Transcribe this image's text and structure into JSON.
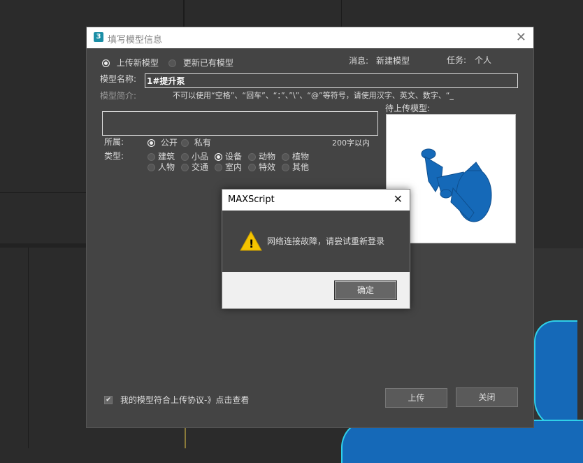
{
  "window": {
    "title": "填写模型信息",
    "close_glyph": "✕",
    "mode_new": "上传新模型",
    "mode_update": "更新已有模型",
    "message_label": "消息:",
    "message_value": "新建模型",
    "task_label": "任务:",
    "task_value": "个人",
    "name_label": "模型名称:",
    "name_value": "1#提升泵",
    "desc_label": "模型简介:",
    "desc_hint": "不可以使用“空格”、“回车”、“：”、”\\”、“@”等符号，请使用汉字、英文、数字、“_",
    "preview_label": "待上传模型:",
    "owner_label": "所属:",
    "owner_public": "公开",
    "owner_private": "私有",
    "char_limit": "200字以内",
    "type_label": "类型:",
    "types_row1": [
      "建筑",
      "小品",
      "设备",
      "动物",
      "植物"
    ],
    "types_row2": [
      "人物",
      "交通",
      "室内",
      "特效",
      "其他"
    ],
    "selected_type": "设备",
    "agree_text": "我的模型符合上传协议-》点击查看",
    "agree_checked": "✔",
    "upload_button": "上传",
    "close_button": "关闭"
  },
  "dialog": {
    "title": "MAXScript",
    "close_glyph": "✕",
    "warning_glyph": "!",
    "message": "网络连接故障，请尝试重新登录",
    "ok_button": "确定"
  },
  "colors": {
    "model_blue": "#1569b8",
    "highlight_cyan": "#2fd0e8",
    "warning_yellow": "#f5c400"
  }
}
